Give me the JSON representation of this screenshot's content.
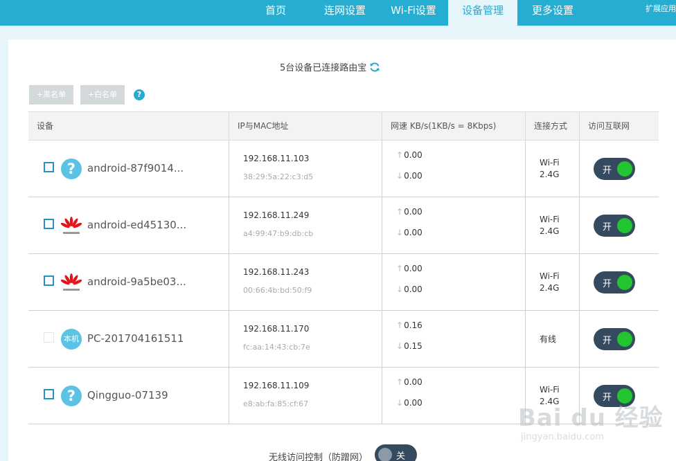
{
  "nav": {
    "items": [
      {
        "label": "首页"
      },
      {
        "label": "连网设置"
      },
      {
        "label": "Wi-Fi设置"
      },
      {
        "label": "设备管理"
      },
      {
        "label": "更多设置"
      }
    ],
    "active_index": 3,
    "extension_label": "扩展应用"
  },
  "summary": {
    "text": "5台设备已连接路由宝",
    "icon": "refresh-icon"
  },
  "buttons": {
    "blacklist": "+黑名单",
    "whitelist": "+白名单",
    "help": "?"
  },
  "table": {
    "headers": [
      "设备",
      "IP与MAC地址",
      "网速 KB/s(1KB/s = 8Kbps)",
      "连接方式",
      "访问互联网"
    ],
    "rows": [
      {
        "name": "android-87f9014...",
        "icon": "question-icon",
        "ip": "192.168.11.103",
        "mac": "38:29:5a:22:c3:d5",
        "up": "0.00",
        "down": "0.00",
        "conn": "Wi-Fi\n2.4G",
        "toggle": "开",
        "checkbox_enabled": true
      },
      {
        "name": "android-ed45130...",
        "icon": "huawei-logo-icon",
        "ip": "192.168.11.249",
        "mac": "a4:99:47:b9:db:cb",
        "up": "0.00",
        "down": "0.00",
        "conn": "Wi-Fi\n2.4G",
        "toggle": "开",
        "checkbox_enabled": true
      },
      {
        "name": "android-9a5be03...",
        "icon": "huawei-logo-icon",
        "ip": "192.168.11.243",
        "mac": "00:66:4b:bd:50:f9",
        "up": "0.00",
        "down": "0.00",
        "conn": "Wi-Fi\n2.4G",
        "toggle": "开",
        "checkbox_enabled": true
      },
      {
        "name": "PC-201704161511",
        "icon": "self-device-icon",
        "icon_text": "本机",
        "ip": "192.168.11.170",
        "mac": "fc:aa:14:43:cb:7e",
        "up": "0.16",
        "down": "0.15",
        "conn": "有线",
        "toggle": "开",
        "checkbox_enabled": false
      },
      {
        "name": "Qingguo-07139",
        "icon": "question-icon",
        "ip": "192.168.11.109",
        "mac": "e8:ab:fa:85:cf:67",
        "up": "0.00",
        "down": "0.00",
        "conn": "Wi-Fi\n2.4G",
        "toggle": "开",
        "checkbox_enabled": true
      }
    ]
  },
  "bottom": {
    "label": "无线访问控制（防蹭网）",
    "toggle": "关"
  },
  "colors": {
    "nav_bg": "#25aed2",
    "toggle_bg": "#354a5f",
    "toggle_on": "#22c42f",
    "accent": "#2aa9cf"
  },
  "watermark": {
    "main": "Bai du 经验",
    "sub": "jingyan.baidu.com"
  }
}
